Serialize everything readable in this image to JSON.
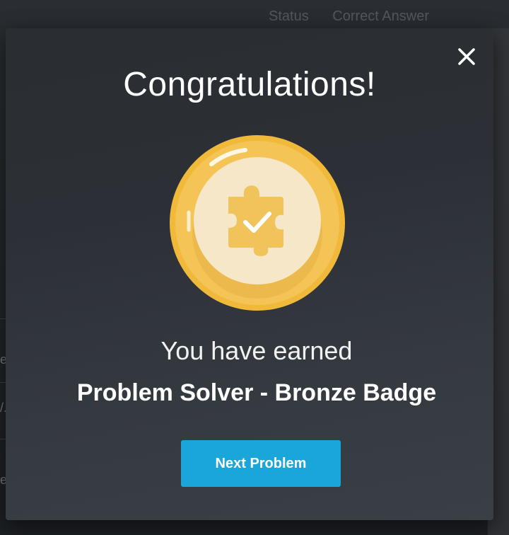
{
  "background": {
    "header_columns": [
      "Status",
      "Correct Answer"
    ],
    "left_fragments": [
      "e b",
      "/. T",
      "exp"
    ]
  },
  "modal": {
    "close_icon": "close-icon",
    "title": "Congratulations!",
    "badge_icon": "puzzle-piece-check-icon",
    "earned_text": "You have earned",
    "badge_name": "Problem Solver - Bronze Badge",
    "next_button_label": "Next Problem"
  },
  "colors": {
    "accent_button": "#1aa6d8",
    "badge_gold": "#f2c14a",
    "badge_cream": "#f6e7c9"
  }
}
